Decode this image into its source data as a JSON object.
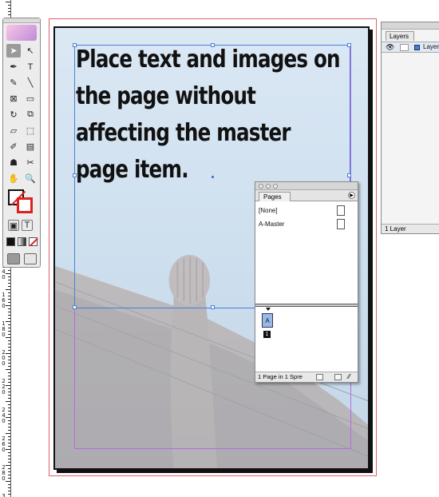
{
  "headline": "Place text and images on the page without affecting the master page item.",
  "ruler": {
    "labels": [
      "1\n4\n0",
      "1\n6\n0",
      "1\n8\n0",
      "2\n0\n0",
      "2\n2\n0",
      "2\n4\n0",
      "2\n6\n0",
      "2\n8\n0",
      "3\n0\n0"
    ]
  },
  "toolbox": {
    "tools": [
      {
        "name": "selection-tool",
        "glyph": "➤",
        "selected": true
      },
      {
        "name": "direct-selection-tool",
        "glyph": "↖"
      },
      {
        "name": "pen-tool",
        "glyph": "✒"
      },
      {
        "name": "type-tool",
        "glyph": "T"
      },
      {
        "name": "pencil-tool",
        "glyph": "✎"
      },
      {
        "name": "line-tool",
        "glyph": "╲"
      },
      {
        "name": "rectangle-frame-tool",
        "glyph": "⊠"
      },
      {
        "name": "rectangle-tool",
        "glyph": "▭"
      },
      {
        "name": "rotate-tool",
        "glyph": "↻"
      },
      {
        "name": "scale-tool",
        "glyph": "⧉"
      },
      {
        "name": "shear-tool",
        "glyph": "▱"
      },
      {
        "name": "free-transform-tool",
        "glyph": "⬚"
      },
      {
        "name": "eyedropper-tool",
        "glyph": "✐"
      },
      {
        "name": "gradient-tool",
        "glyph": "▤"
      },
      {
        "name": "button-tool",
        "glyph": "☗"
      },
      {
        "name": "scissors-tool",
        "glyph": "✂"
      },
      {
        "name": "hand-tool",
        "glyph": "✋"
      },
      {
        "name": "zoom-tool",
        "glyph": "🔍"
      }
    ],
    "apply_text_glyph": "T"
  },
  "layers_panel": {
    "tab": "Layers",
    "layer_name": "Layer",
    "footer": "1 Layer",
    "layer_color": "#3f7fe0"
  },
  "pages_panel": {
    "tab": "Pages",
    "masters": [
      "[None]",
      "A-Master"
    ],
    "page_thumb_label": "A",
    "page_number": "1",
    "footer": "1 Page in 1 Spre"
  },
  "colors": {
    "frame_selection": "#4a7fd6",
    "margin_guide": "#b36be0",
    "bleed_guide": "#e0606a"
  }
}
